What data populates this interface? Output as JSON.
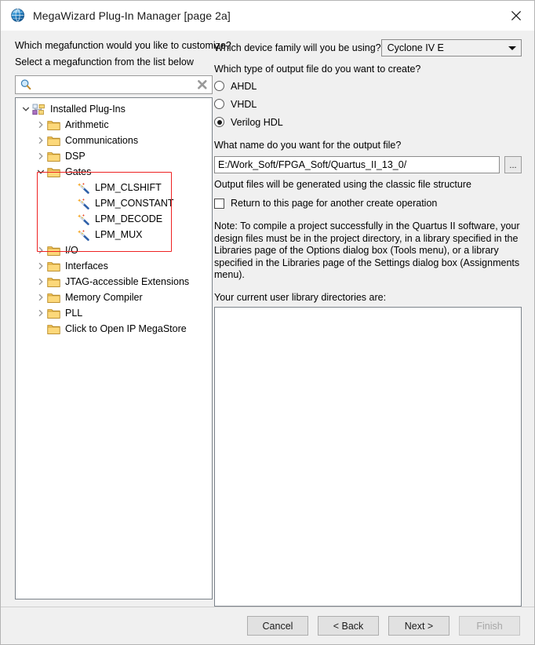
{
  "window": {
    "title": "MegaWizard Plug-In Manager [page 2a]",
    "icon": "globe-icon",
    "close_label": "✕"
  },
  "left": {
    "question": "Which megafunction would you like to customize?",
    "instruction": "Select a megafunction from the list below",
    "search": {
      "value": "",
      "placeholder": "",
      "search_icon": "magnifier-icon",
      "clear_icon": "clear-x-icon"
    },
    "tree": [
      {
        "label": "Installed Plug-Ins",
        "level": 0,
        "icon": "plugins-icon",
        "expanded": true,
        "arrow": "chevron-down"
      },
      {
        "label": "Arithmetic",
        "level": 1,
        "icon": "folder-icon",
        "expanded": false,
        "arrow": "chevron-right"
      },
      {
        "label": "Communications",
        "level": 1,
        "icon": "folder-icon",
        "expanded": false,
        "arrow": "chevron-right"
      },
      {
        "label": "DSP",
        "level": 1,
        "icon": "folder-icon",
        "expanded": false,
        "arrow": "chevron-right"
      },
      {
        "label": "Gates",
        "level": 1,
        "icon": "folder-icon",
        "expanded": true,
        "arrow": "chevron-down"
      },
      {
        "label": "LPM_CLSHIFT",
        "level": 2,
        "icon": "wand-icon",
        "expanded": null,
        "arrow": "none"
      },
      {
        "label": "LPM_CONSTANT",
        "level": 2,
        "icon": "wand-icon",
        "expanded": null,
        "arrow": "none"
      },
      {
        "label": "LPM_DECODE",
        "level": 2,
        "icon": "wand-icon",
        "expanded": null,
        "arrow": "none"
      },
      {
        "label": "LPM_MUX",
        "level": 2,
        "icon": "wand-icon",
        "expanded": null,
        "arrow": "none"
      },
      {
        "label": "I/O",
        "level": 1,
        "icon": "folder-icon",
        "expanded": false,
        "arrow": "chevron-right"
      },
      {
        "label": "Interfaces",
        "level": 1,
        "icon": "folder-icon",
        "expanded": false,
        "arrow": "chevron-right"
      },
      {
        "label": "JTAG-accessible Extensions",
        "level": 1,
        "icon": "folder-icon",
        "expanded": false,
        "arrow": "chevron-right"
      },
      {
        "label": "Memory Compiler",
        "level": 1,
        "icon": "folder-icon",
        "expanded": false,
        "arrow": "chevron-right"
      },
      {
        "label": "PLL",
        "level": 1,
        "icon": "folder-icon",
        "expanded": false,
        "arrow": "chevron-right"
      },
      {
        "label": "Click to Open IP MegaStore",
        "level": 1,
        "icon": "folder-icon",
        "expanded": null,
        "arrow": "none"
      }
    ],
    "annotation_color": "#ee2222"
  },
  "right": {
    "device_family_label": "Which device family will you be using?",
    "device_family_value": "Cyclone IV E",
    "output_type_label": "Which type of output file do you want to create?",
    "output_types": [
      {
        "label": "AHDL",
        "checked": false
      },
      {
        "label": "VHDL",
        "checked": false
      },
      {
        "label": "Verilog HDL",
        "checked": true
      }
    ],
    "output_name_label": "What name do you want for the output file?",
    "output_name_value": "E:/Work_Soft/FPGA_Soft/Quartus_II_13_0/",
    "browse_label": "...",
    "file_structure_note": "Output files will be generated using the classic file structure",
    "return_checkbox": {
      "label": "Return to this page for another create operation",
      "checked": false
    },
    "note_paragraph": "Note: To compile a project successfully in the Quartus II software, your design files must be in the project directory, in a library specified in the Libraries page of the Options dialog box (Tools menu), or a library specified in the Libraries page of the Settings dialog box (Assignments menu).",
    "library_label": "Your current user library directories are:",
    "library_entries": []
  },
  "footer": {
    "buttons": [
      {
        "label": "Cancel",
        "disabled": false
      },
      {
        "label": "< Back",
        "disabled": false
      },
      {
        "label": "Next >",
        "disabled": false
      },
      {
        "label": "Finish",
        "disabled": true
      }
    ]
  }
}
